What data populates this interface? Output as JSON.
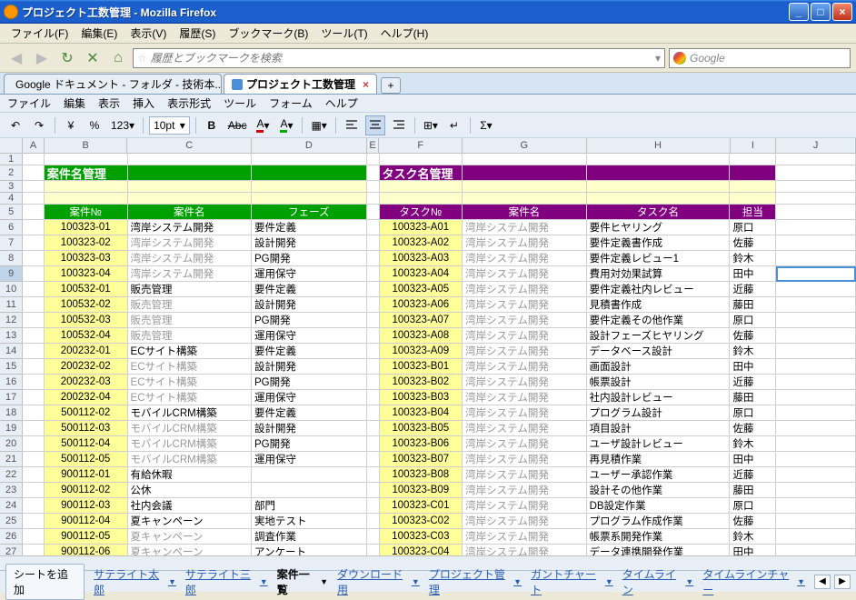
{
  "window": {
    "title": "プロジェクト工数管理 - Mozilla Firefox"
  },
  "browser_menu": [
    "ファイル(F)",
    "編集(E)",
    "表示(V)",
    "履歴(S)",
    "ブックマーク(B)",
    "ツール(T)",
    "ヘルプ(H)"
  ],
  "urlbar_placeholder": "履歴とブックマークを検索",
  "searchbox_placeholder": "Google",
  "tabs": [
    {
      "label": "Google ドキュメント - フォルダ - 技術本...",
      "active": false
    },
    {
      "label": "プロジェクト工数管理",
      "active": true
    }
  ],
  "gd_menu": [
    "ファイル",
    "編集",
    "表示",
    "挿入",
    "表示形式",
    "ツール",
    "フォーム",
    "ヘルプ"
  ],
  "toolbar": {
    "font_size": "10pt",
    "percent": "%",
    "yen": "¥",
    "num": "123"
  },
  "columns": [
    "A",
    "B",
    "C",
    "D",
    "E",
    "F",
    "G",
    "H",
    "I",
    "J"
  ],
  "row_start": 1,
  "row_end": 28,
  "selected_row": 9,
  "hdr_left": {
    "title": "案件名管理",
    "cols": [
      "案件№",
      "案件名",
      "フェーズ"
    ]
  },
  "hdr_right": {
    "title": "タスク名管理",
    "cols": [
      "タスク№",
      "案件名",
      "タスク名",
      "担当"
    ]
  },
  "left_rows": [
    {
      "no": "100323-01",
      "name": "湾岸システム開発",
      "phase": "要件定義",
      "gray": false
    },
    {
      "no": "100323-02",
      "name": "湾岸システム開発",
      "phase": "設計開発",
      "gray": true
    },
    {
      "no": "100323-03",
      "name": "湾岸システム開発",
      "phase": "PG開発",
      "gray": true
    },
    {
      "no": "100323-04",
      "name": "湾岸システム開発",
      "phase": "運用保守",
      "gray": true
    },
    {
      "no": "100532-01",
      "name": "販売管理",
      "phase": "要件定義",
      "gray": false
    },
    {
      "no": "100532-02",
      "name": "販売管理",
      "phase": "設計開発",
      "gray": true
    },
    {
      "no": "100532-03",
      "name": "販売管理",
      "phase": "PG開発",
      "gray": true
    },
    {
      "no": "100532-04",
      "name": "販売管理",
      "phase": "運用保守",
      "gray": true
    },
    {
      "no": "200232-01",
      "name": "ECサイト構築",
      "phase": "要件定義",
      "gray": false
    },
    {
      "no": "200232-02",
      "name": "ECサイト構築",
      "phase": "設計開発",
      "gray": true
    },
    {
      "no": "200232-03",
      "name": "ECサイト構築",
      "phase": "PG開発",
      "gray": true
    },
    {
      "no": "200232-04",
      "name": "ECサイト構築",
      "phase": "運用保守",
      "gray": true
    },
    {
      "no": "500112-02",
      "name": "モバイルCRM構築",
      "phase": "要件定義",
      "gray": false
    },
    {
      "no": "500112-03",
      "name": "モバイルCRM構築",
      "phase": "設計開発",
      "gray": true
    },
    {
      "no": "500112-04",
      "name": "モバイルCRM構築",
      "phase": "PG開発",
      "gray": true
    },
    {
      "no": "500112-05",
      "name": "モバイルCRM構築",
      "phase": "運用保守",
      "gray": true
    },
    {
      "no": "900112-01",
      "name": "有給休暇",
      "phase": "",
      "gray": false
    },
    {
      "no": "900112-02",
      "name": "公休",
      "phase": "",
      "gray": false
    },
    {
      "no": "900112-03",
      "name": "社内会議",
      "phase": "部門",
      "gray": false
    },
    {
      "no": "900112-04",
      "name": "夏キャンペーン",
      "phase": "実地テスト",
      "gray": false
    },
    {
      "no": "900112-05",
      "name": "夏キャンペーン",
      "phase": "調査作業",
      "gray": true
    },
    {
      "no": "900112-06",
      "name": "夏キャンペーン",
      "phase": "アンケート",
      "gray": true
    }
  ],
  "right_rows": [
    {
      "no": "100323-A01",
      "name": "湾岸システム開発",
      "task": "要件ヒヤリング",
      "owner": "原口"
    },
    {
      "no": "100323-A02",
      "name": "湾岸システム開発",
      "task": "要件定義書作成",
      "owner": "佐藤"
    },
    {
      "no": "100323-A03",
      "name": "湾岸システム開発",
      "task": "要件定義レビュー1",
      "owner": "鈴木"
    },
    {
      "no": "100323-A04",
      "name": "湾岸システム開発",
      "task": "費用対効果試算",
      "owner": "田中"
    },
    {
      "no": "100323-A05",
      "name": "湾岸システム開発",
      "task": "要件定義社内レビュー",
      "owner": "近藤"
    },
    {
      "no": "100323-A06",
      "name": "湾岸システム開発",
      "task": "見積書作成",
      "owner": "藤田"
    },
    {
      "no": "100323-A07",
      "name": "湾岸システム開発",
      "task": "要件定義その他作業",
      "owner": "原口"
    },
    {
      "no": "100323-A08",
      "name": "湾岸システム開発",
      "task": "設計フェーズヒヤリング",
      "owner": "佐藤"
    },
    {
      "no": "100323-A09",
      "name": "湾岸システム開発",
      "task": "データベース設計",
      "owner": "鈴木"
    },
    {
      "no": "100323-B01",
      "name": "湾岸システム開発",
      "task": "画面設計",
      "owner": "田中"
    },
    {
      "no": "100323-B02",
      "name": "湾岸システム開発",
      "task": "帳票設計",
      "owner": "近藤"
    },
    {
      "no": "100323-B03",
      "name": "湾岸システム開発",
      "task": "社内設計レビュー",
      "owner": "藤田"
    },
    {
      "no": "100323-B04",
      "name": "湾岸システム開発",
      "task": "プログラム設計",
      "owner": "原口"
    },
    {
      "no": "100323-B05",
      "name": "湾岸システム開発",
      "task": "項目設計",
      "owner": "佐藤"
    },
    {
      "no": "100323-B06",
      "name": "湾岸システム開発",
      "task": "ユーザ設計レビュー",
      "owner": "鈴木"
    },
    {
      "no": "100323-B07",
      "name": "湾岸システム開発",
      "task": "再見積作業",
      "owner": "田中"
    },
    {
      "no": "100323-B08",
      "name": "湾岸システム開発",
      "task": "ユーザー承認作業",
      "owner": "近藤"
    },
    {
      "no": "100323-B09",
      "name": "湾岸システム開発",
      "task": "設計その他作業",
      "owner": "藤田"
    },
    {
      "no": "100323-C01",
      "name": "湾岸システム開発",
      "task": "DB設定作業",
      "owner": "原口"
    },
    {
      "no": "100323-C02",
      "name": "湾岸システム開発",
      "task": "プログラム作成作業",
      "owner": "佐藤"
    },
    {
      "no": "100323-C03",
      "name": "湾岸システム開発",
      "task": "帳票系開発作業",
      "owner": "鈴木"
    },
    {
      "no": "100323-C04",
      "name": "湾岸システム開発",
      "task": "データ連携開発作業",
      "owner": "田中"
    }
  ],
  "sheet_tabs": {
    "add": "シートを追加",
    "tabs": [
      "サテライト太郎",
      "サテライト三郎",
      "案件一覧",
      "ダウンロード用",
      "プロジェクト管理",
      "ガントチャート",
      "タイムライン",
      "タイムラインチャー"
    ],
    "active": 2
  }
}
